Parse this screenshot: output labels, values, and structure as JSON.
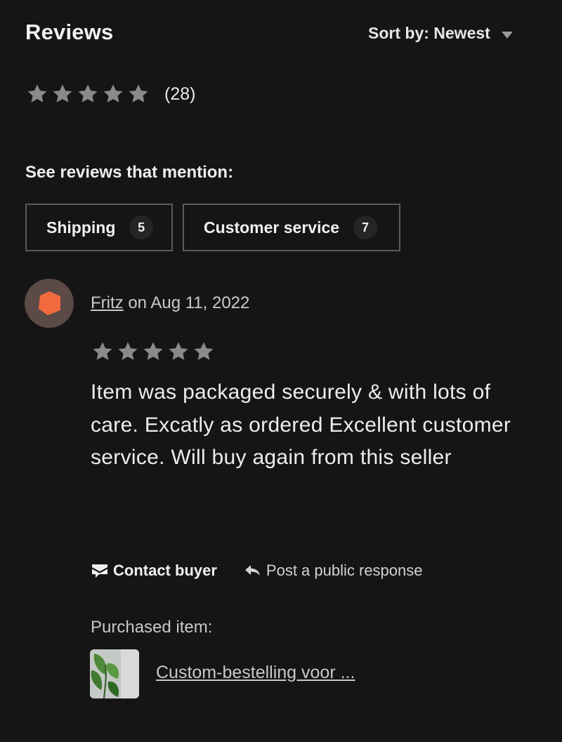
{
  "header": {
    "title": "Reviews",
    "sort_label": "Sort by: Newest"
  },
  "summary": {
    "rating": 5,
    "rating_max": 5,
    "count_text": "(28)"
  },
  "mentions": {
    "heading": "See reviews that mention:",
    "chips": [
      {
        "label": "Shipping",
        "count": "5"
      },
      {
        "label": "Customer service",
        "count": "7"
      }
    ]
  },
  "review": {
    "reviewer": "Fritz",
    "date_text": " on Aug 11, 2022",
    "rating": 5,
    "text": "Item was packaged securely & with lots of care. Excatly as ordered Excellent customer service. Will buy again from this seller",
    "actions": {
      "contact": "Contact buyer",
      "respond": "Post a public response"
    },
    "purchased_label": "Purchased item:",
    "item_title": "Custom-bestelling voor ..."
  },
  "colors": {
    "background": "#151515",
    "star": "#8a8a8a",
    "avatar_bg": "#5b4a45",
    "avatar_shape": "#f26a3d"
  },
  "icons": [
    "chevron-down-icon",
    "star-icon",
    "mail-icon",
    "reply-arrow-icon"
  ]
}
